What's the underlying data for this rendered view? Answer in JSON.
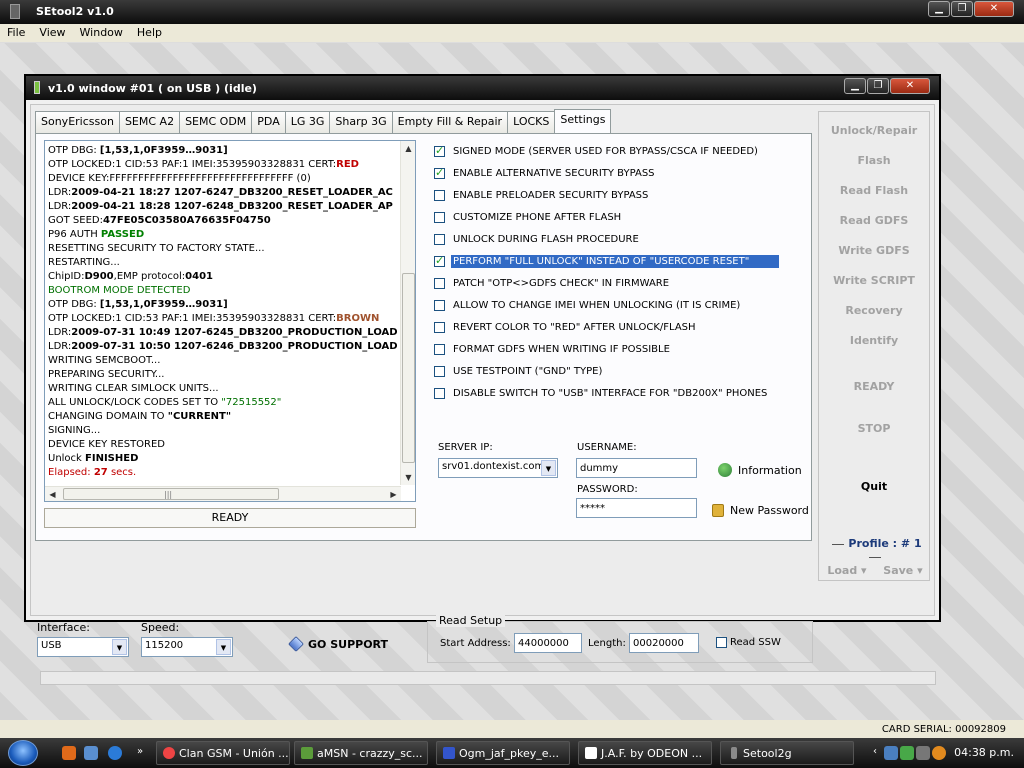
{
  "app": {
    "title": "SEtool2 v1.0",
    "menu": [
      "File",
      "View",
      "Window",
      "Help"
    ]
  },
  "window": {
    "title": "v1.0 window #01 ( on USB ) (idle)"
  },
  "tabs": [
    "SonyEricsson",
    "SEMC A2",
    "SEMC ODM",
    "PDA",
    "LG 3G",
    "Sharp 3G",
    "Empty Fill & Repair",
    "LOCKS",
    "Settings"
  ],
  "active_tab": "Settings",
  "log": [
    {
      "parts": [
        {
          "t": "OTP DBG: "
        },
        {
          "t": "[1,53,1,0F3959…9031]",
          "b": true
        }
      ]
    },
    {
      "parts": [
        {
          "t": "OTP LOCKED:1 CID:53 PAF:1 IMEI:35395903328831 CERT:"
        },
        {
          "t": "RED",
          "b": true,
          "c": "red"
        }
      ]
    },
    {
      "parts": [
        {
          "t": "DEVICE KEY:FFFFFFFFFFFFFFFFFFFFFFFFFFFFFFFF (0)"
        }
      ]
    },
    {
      "parts": [
        {
          "t": "LDR:"
        },
        {
          "t": "2009-04-21 18:27 1207-6247_DB3200_RESET_LOADER_AC",
          "b": true
        }
      ]
    },
    {
      "parts": [
        {
          "t": "LDR:"
        },
        {
          "t": "2009-04-21 18:28 1207-6248_DB3200_RESET_LOADER_AP",
          "b": true
        }
      ]
    },
    {
      "parts": [
        {
          "t": "GOT SEED:"
        },
        {
          "t": "47FE05C03580A76635F04750",
          "b": true
        }
      ]
    },
    {
      "parts": [
        {
          "t": "P96 AUTH "
        },
        {
          "t": "PASSED",
          "b": true,
          "c": "green"
        }
      ]
    },
    {
      "parts": [
        {
          "t": "RESETTING SECURITY TO FACTORY STATE..."
        }
      ]
    },
    {
      "parts": [
        {
          "t": "RESTARTING..."
        }
      ]
    },
    {
      "parts": [
        {
          "t": "ChipID:"
        },
        {
          "t": "D900",
          "b": true
        },
        {
          "t": ",EMP protocol:"
        },
        {
          "t": "0401",
          "b": true
        }
      ]
    },
    {
      "parts": [
        {
          "t": "BOOTROM MODE DETECTED",
          "c": "darkgreen"
        }
      ]
    },
    {
      "parts": [
        {
          "t": "OTP DBG: "
        },
        {
          "t": "[1,53,1,0F3959…9031]",
          "b": true
        }
      ]
    },
    {
      "parts": [
        {
          "t": "OTP LOCKED:1 CID:53 PAF:1 IMEI:35395903328831 CERT:"
        },
        {
          "t": "BROWN",
          "b": true,
          "c": "brown"
        }
      ]
    },
    {
      "parts": [
        {
          "t": "LDR:"
        },
        {
          "t": "2009-07-31 10:49 1207-6245_DB3200_PRODUCTION_LOAD",
          "b": true
        }
      ]
    },
    {
      "parts": [
        {
          "t": "LDR:"
        },
        {
          "t": "2009-07-31 10:50 1207-6246_DB3200_PRODUCTION_LOAD",
          "b": true
        }
      ]
    },
    {
      "parts": [
        {
          "t": "WRITING SEMCBOOT..."
        }
      ]
    },
    {
      "parts": [
        {
          "t": "PREPARING SECURITY..."
        }
      ]
    },
    {
      "parts": [
        {
          "t": "WRITING CLEAR SIMLOCK UNITS..."
        }
      ]
    },
    {
      "parts": [
        {
          "t": "ALL UNLOCK/LOCK CODES SET TO "
        },
        {
          "t": "\"72515552\"",
          "c": "darkgreen"
        }
      ]
    },
    {
      "parts": [
        {
          "t": "CHANGING DOMAIN TO "
        },
        {
          "t": "\"CURRENT\"",
          "b": true
        }
      ]
    },
    {
      "parts": [
        {
          "t": "SIGNING..."
        }
      ]
    },
    {
      "parts": [
        {
          "t": "DEVICE KEY RESTORED"
        }
      ]
    },
    {
      "parts": [
        {
          "t": "Unlock "
        },
        {
          "t": "FINISHED",
          "b": true
        }
      ]
    },
    {
      "parts": [
        {
          "t": "Elapsed: ",
          "c": "red"
        },
        {
          "t": "27",
          "b": true,
          "c": "red"
        },
        {
          "t": " secs.",
          "c": "red"
        }
      ]
    }
  ],
  "status": "READY",
  "settings": [
    {
      "label": "SIGNED MODE (SERVER USED FOR BYPASS/CSCA IF NEEDED)",
      "checked": true
    },
    {
      "label": "ENABLE ALTERNATIVE SECURITY BYPASS",
      "checked": true
    },
    {
      "label": "ENABLE PRELOADER SECURITY BYPASS",
      "checked": false
    },
    {
      "label": "CUSTOMIZE PHONE AFTER FLASH",
      "checked": false
    },
    {
      "label": "UNLOCK DURING FLASH PROCEDURE",
      "checked": false
    },
    {
      "label": "PERFORM \"FULL UNLOCK\" INSTEAD OF \"USERCODE RESET\"",
      "checked": true,
      "highlight": true
    },
    {
      "label": "PATCH \"OTP<>GDFS CHECK\" IN FIRMWARE",
      "checked": false
    },
    {
      "label": "ALLOW TO CHANGE IMEI WHEN UNLOCKING (IT IS CRIME)",
      "checked": false
    },
    {
      "label": "REVERT COLOR TO \"RED\" AFTER UNLOCK/FLASH",
      "checked": false
    },
    {
      "label": "FORMAT GDFS WHEN WRITING IF POSSIBLE",
      "checked": false
    },
    {
      "label": "USE TESTPOINT (\"GND\" TYPE)",
      "checked": false
    },
    {
      "label": "DISABLE SWITCH TO \"USB\" INTERFACE FOR \"DB200X\" PHONES",
      "checked": false
    }
  ],
  "server": {
    "ip_label": "SERVER IP:",
    "ip_value": "srv01.dontexist.com",
    "username_label": "USERNAME:",
    "username_value": "dummy",
    "password_label": "PASSWORD:",
    "password_value": "*****",
    "information_label": "Information",
    "new_password_label": "New Password"
  },
  "side_buttons": [
    "Unlock/Repair",
    "Flash",
    "Read Flash",
    "Read GDFS",
    "Write GDFS",
    "Write SCRIPT",
    "Recovery",
    "Identify",
    "READY",
    "STOP",
    "Quit"
  ],
  "profile": "Profile : # 1",
  "load_label": "Load",
  "save_label": "Save",
  "interface": {
    "label": "Interface:",
    "value": "USB"
  },
  "speed": {
    "label": "Speed:",
    "value": "115200"
  },
  "go_support": "GO SUPPORT",
  "read_setup": {
    "title": "Read Setup",
    "start_label": "Start Address:",
    "start_value": "44000000",
    "length_label": "Length:",
    "length_value": "00020000",
    "read_ssw_label": "Read SSW"
  },
  "card_serial": "CARD SERIAL: 00092809",
  "taskbar": {
    "tasks": [
      "Clan GSM - Unión ...",
      "aMSN - crazzy_sc...",
      "Ogm_jaf_pkey_e...",
      "J.A.F. by ODEON ...",
      "Setool2g"
    ],
    "time": "04:38 p.m."
  }
}
